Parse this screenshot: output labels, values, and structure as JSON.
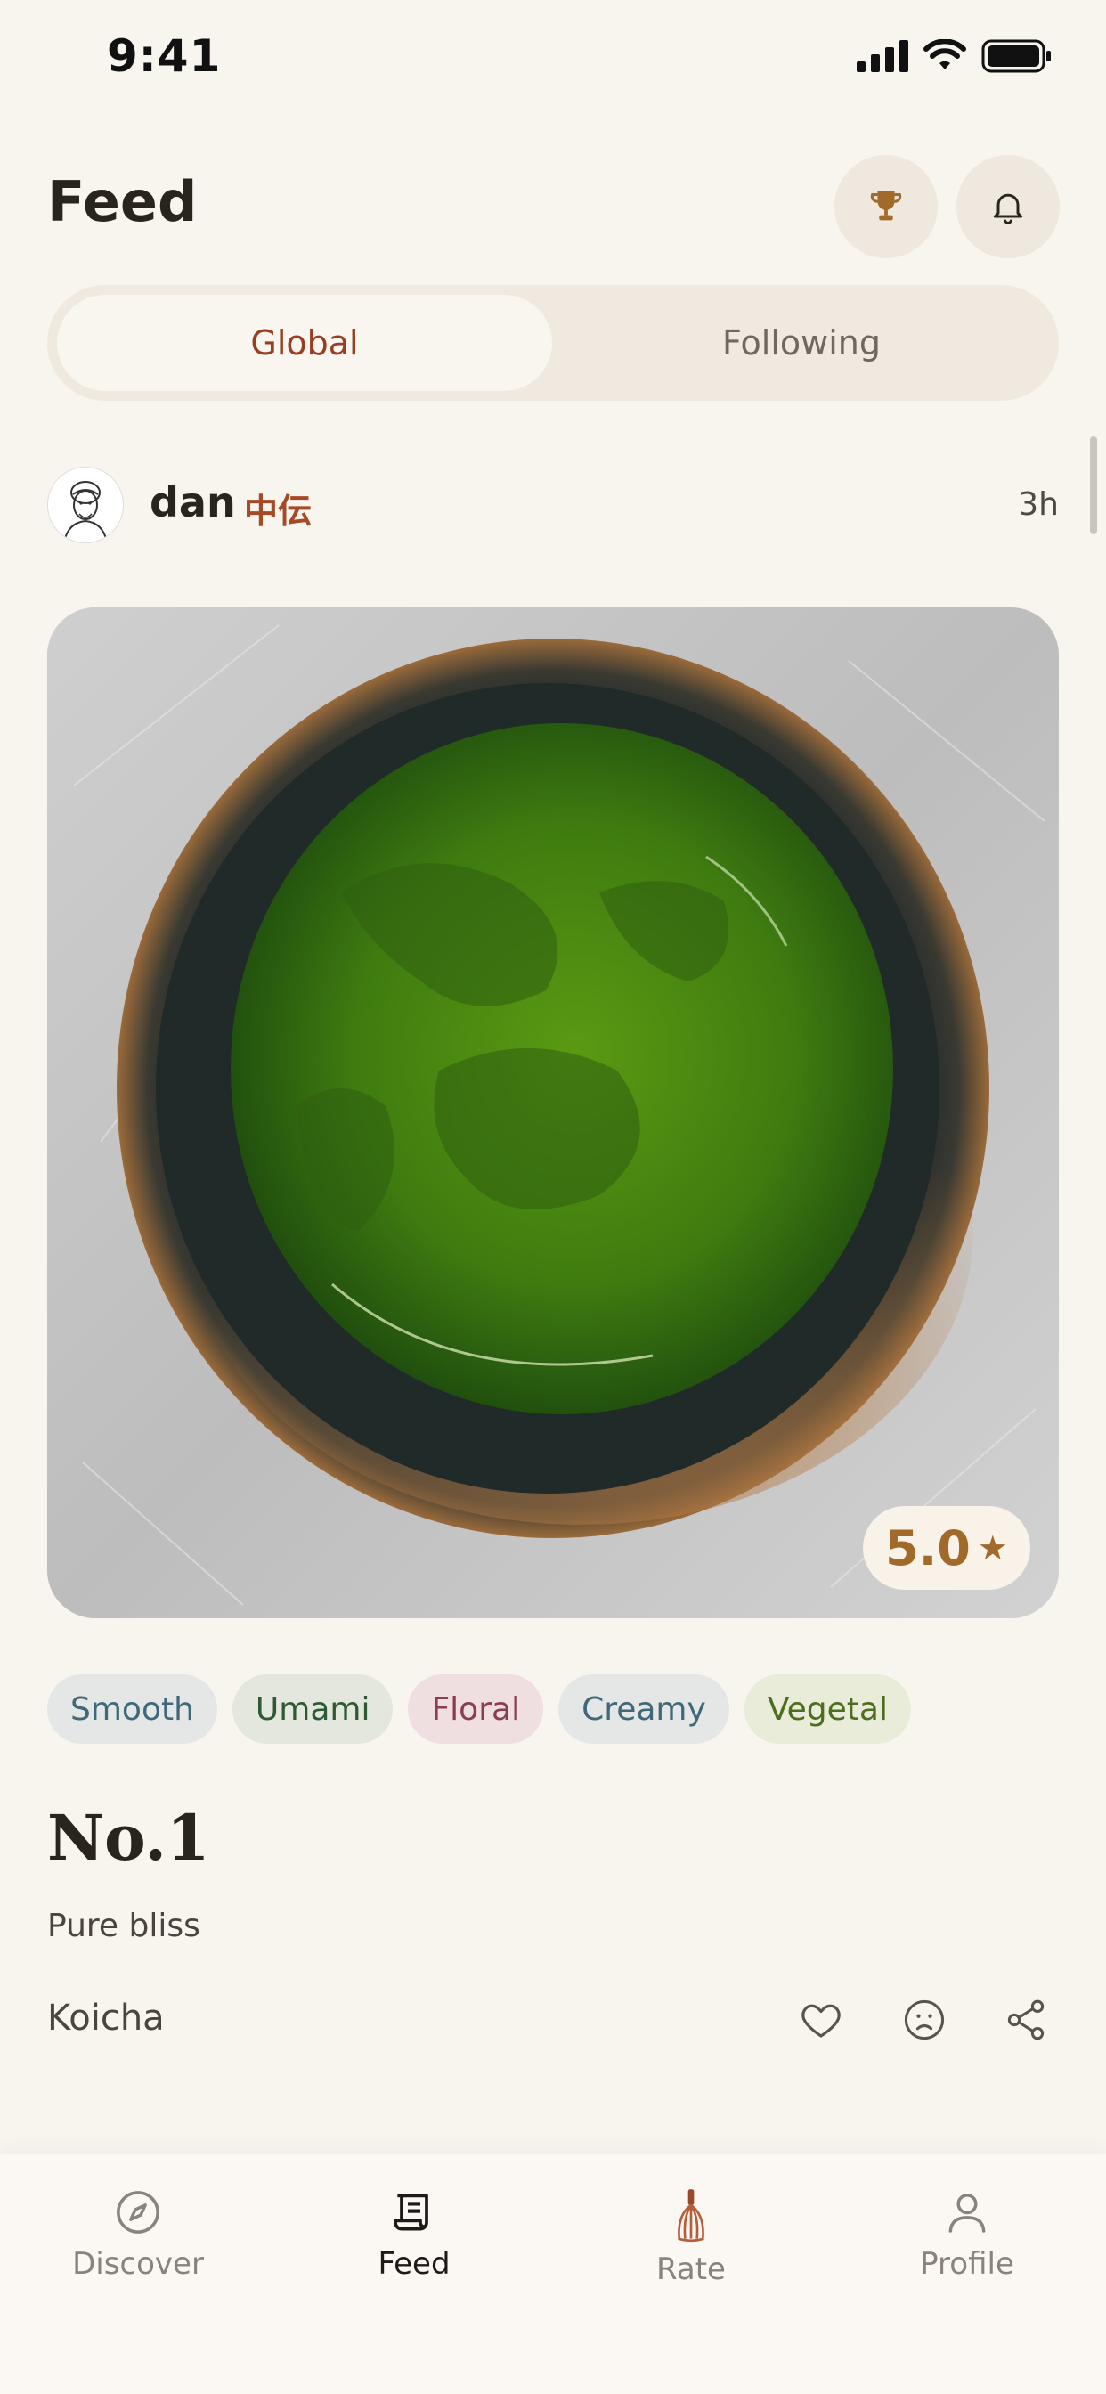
{
  "status_bar": {
    "time": "9:41"
  },
  "header": {
    "title": "Feed",
    "trophy_icon": "trophy-icon",
    "bell_icon": "bell-icon"
  },
  "segments": {
    "global": "Global",
    "following": "Following",
    "selected": "Global"
  },
  "post": {
    "username": "dan",
    "rank": "中伝",
    "time_ago": "3h",
    "rating": "5.0",
    "tags": [
      {
        "label": "Smooth",
        "bg": "#e4e7e6",
        "fg": "#3f6878"
      },
      {
        "label": "Umami",
        "bg": "#e3e7de",
        "fg": "#2e5a33"
      },
      {
        "label": "Floral",
        "bg": "#f0dfe0",
        "fg": "#8b3d52"
      },
      {
        "label": "Creamy",
        "bg": "#e4e7e6",
        "fg": "#3f6878"
      },
      {
        "label": "Vegetal",
        "bg": "#e8ecd9",
        "fg": "#4e6e1f"
      }
    ],
    "title": "No.1",
    "description": "Pure bliss",
    "type": "Koicha"
  },
  "tabbar": {
    "items": [
      {
        "label": "Discover",
        "icon": "compass-icon"
      },
      {
        "label": "Feed",
        "icon": "scroll-icon"
      },
      {
        "label": "Rate",
        "icon": "whisk-icon"
      },
      {
        "label": "Profile",
        "icon": "person-icon"
      }
    ],
    "active": "Feed"
  },
  "colors": {
    "accent": "#a54a26",
    "gold": "#a16a2a",
    "background": "#f8f4ee"
  }
}
